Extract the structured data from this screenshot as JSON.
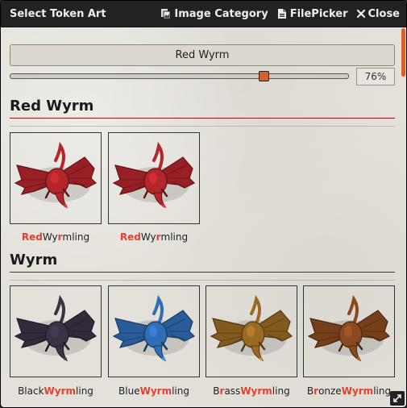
{
  "header": {
    "title": "Select Token Art",
    "image_category_label": "Image Category",
    "filepicker_label": "FilePicker",
    "close_label": "Close"
  },
  "search": {
    "value": "Red Wyrm"
  },
  "zoom": {
    "value": 76,
    "label": "76%"
  },
  "sections": [
    {
      "title": "Red Wyrm",
      "items": [
        {
          "parts": [
            {
              "t": "Red",
              "h": true
            },
            {
              "t": "Wy",
              "h": false
            },
            {
              "t": "r",
              "h": true
            },
            {
              "t": "mling",
              "h": false
            }
          ],
          "color": "#b3262a"
        },
        {
          "parts": [
            {
              "t": "Red",
              "h": true
            },
            {
              "t": "Wy",
              "h": false
            },
            {
              "t": "r",
              "h": true
            },
            {
              "t": "mling",
              "h": false
            }
          ],
          "color": "#b3262a"
        }
      ]
    },
    {
      "title": "Wyrm",
      "items": [
        {
          "parts": [
            {
              "t": "Black",
              "h": false
            },
            {
              "t": "Wyrm",
              "h": true
            },
            {
              "t": "ling",
              "h": false
            }
          ],
          "color": "#3a3346"
        },
        {
          "parts": [
            {
              "t": "Blue",
              "h": false
            },
            {
              "t": "Wyrm",
              "h": true
            },
            {
              "t": "ling",
              "h": false
            }
          ],
          "color": "#2f6db5"
        },
        {
          "parts": [
            {
              "t": "B",
              "h": false
            },
            {
              "t": "r",
              "h": true
            },
            {
              "t": "ass",
              "h": false
            },
            {
              "t": "Wyrm",
              "h": true
            },
            {
              "t": "ling",
              "h": false
            }
          ],
          "color": "#9a6a23"
        },
        {
          "parts": [
            {
              "t": "B",
              "h": false
            },
            {
              "t": "r",
              "h": true
            },
            {
              "t": "onze",
              "h": false
            },
            {
              "t": "Wyrm",
              "h": true
            },
            {
              "t": "ling",
              "h": false
            }
          ],
          "color": "#8a4a1f"
        }
      ]
    }
  ]
}
